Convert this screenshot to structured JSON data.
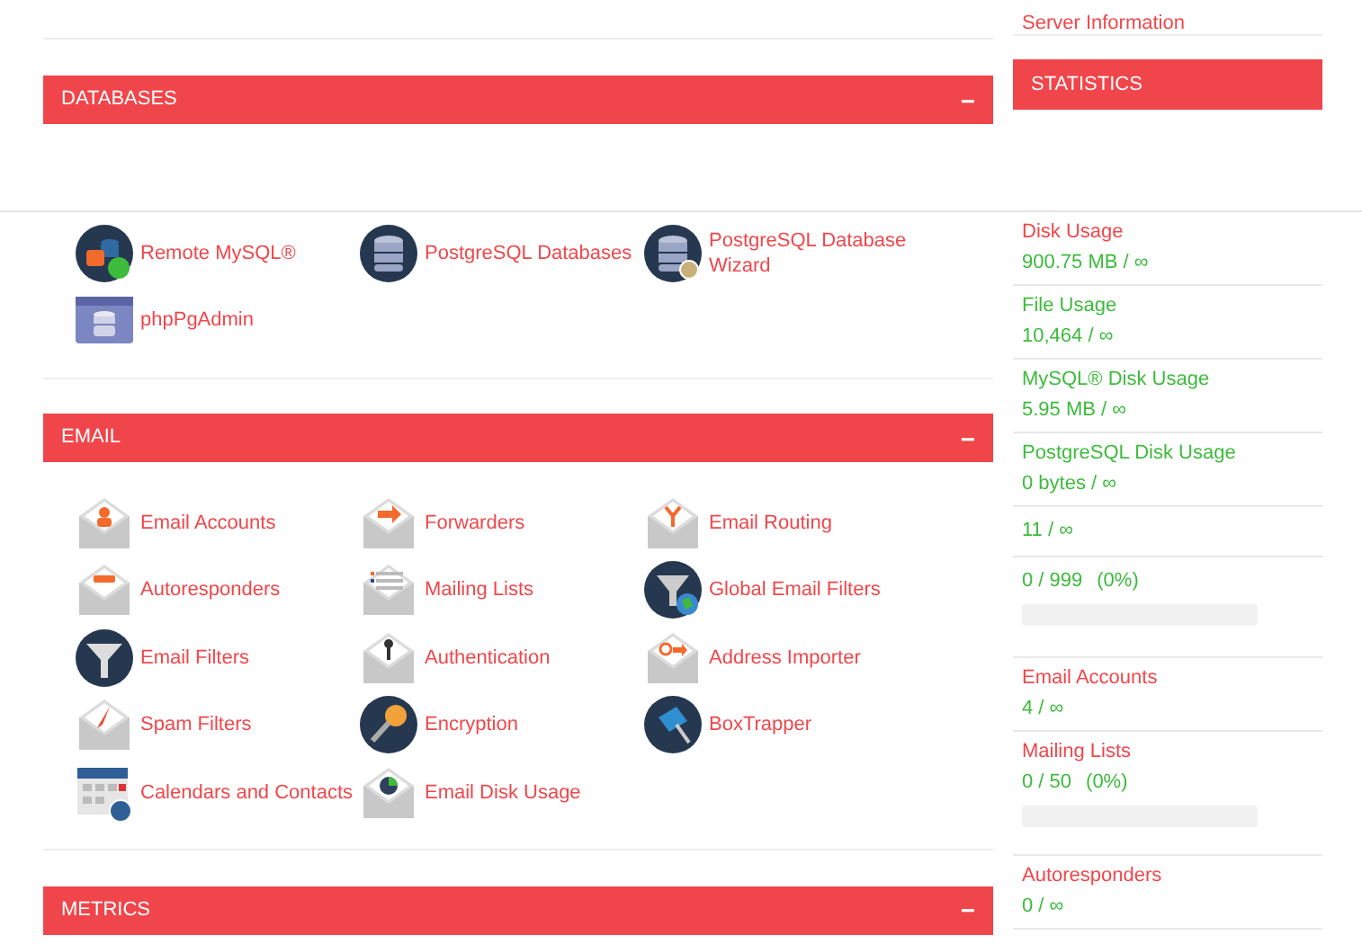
{
  "databases": {
    "title": "DATABASES",
    "collapse_icon": "−",
    "items": [
      {
        "label": "Remote MySQL®"
      },
      {
        "label": "PostgreSQL Databases"
      },
      {
        "label": "PostgreSQL Database Wizard"
      },
      {
        "label": "phpPgAdmin"
      }
    ]
  },
  "email": {
    "title": "EMAIL",
    "collapse_icon": "−",
    "items": [
      {
        "label": "Email Accounts"
      },
      {
        "label": "Forwarders"
      },
      {
        "label": "Email Routing"
      },
      {
        "label": "Autoresponders"
      },
      {
        "label": "Mailing Lists"
      },
      {
        "label": "Global Email Filters"
      },
      {
        "label": "Email Filters"
      },
      {
        "label": "Authentication"
      },
      {
        "label": "Address Importer"
      },
      {
        "label": "Spam Filters"
      },
      {
        "label": "Encryption"
      },
      {
        "label": "BoxTrapper"
      },
      {
        "label": "Calendars and Contacts"
      },
      {
        "label": "Email Disk Usage"
      }
    ]
  },
  "metrics": {
    "title": "METRICS",
    "collapse_icon": "−"
  },
  "sidebar": {
    "server_information": "Server Information",
    "statistics_title": "STATISTICS",
    "stats": [
      {
        "label": "Disk Usage",
        "color": "#f0474b",
        "value": "900.75 MB / ∞"
      },
      {
        "label": "File Usage",
        "color": "#3dbb3d",
        "value": "10,464 / ∞"
      },
      {
        "label": "MySQL® Disk Usage",
        "color": "#3dbb3d",
        "value": "5.95 MB / ∞"
      },
      {
        "label": "PostgreSQL Disk Usage",
        "color": "#3dbb3d",
        "value": "0 bytes / ∞"
      },
      {
        "value": "11 / ∞"
      },
      {
        "value": "0 / 999",
        "percent": "(0%)",
        "level": 0
      },
      {
        "label": "Email Accounts",
        "color": "#f0474b",
        "value": "4 / ∞"
      },
      {
        "label": "Mailing Lists",
        "color": "#f0474b",
        "value": "0 / 50",
        "percent": "(0%)",
        "level": 0
      },
      {
        "label": "Autoresponders",
        "color": "#f0474b",
        "value": "0 / ∞"
      }
    ]
  }
}
